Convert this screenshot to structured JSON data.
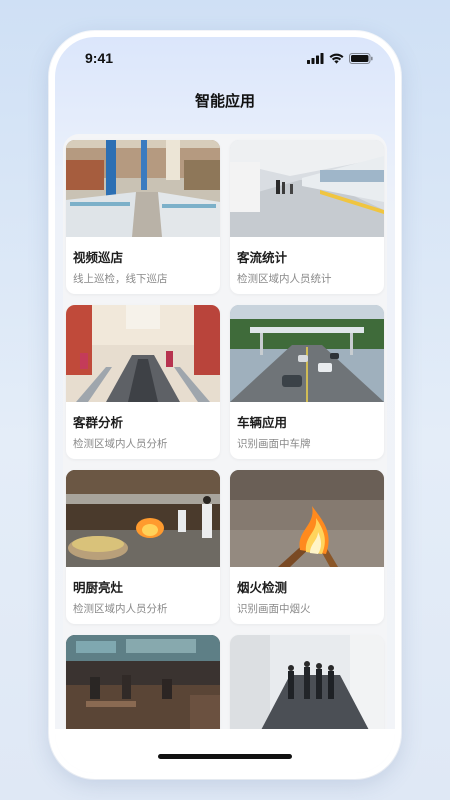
{
  "status_bar": {
    "time": "9:41",
    "icons": [
      "signal-icon",
      "wifi-icon",
      "battery-icon"
    ]
  },
  "header": {
    "title": "智能应用"
  },
  "apps": [
    {
      "id": "video-patrol",
      "title": "视频巡店",
      "desc": "线上巡检，线下巡店",
      "image": "supermarket-aisle"
    },
    {
      "id": "foot-traffic",
      "title": "客流统计",
      "desc": "检测区域内人员统计",
      "image": "metro-station-platform"
    },
    {
      "id": "customer-group",
      "title": "客群分析",
      "desc": "检测区域内人员分析",
      "image": "mall-escalator"
    },
    {
      "id": "vehicle",
      "title": "车辆应用",
      "desc": "识别画面中车牌",
      "image": "highway-toll-gate"
    },
    {
      "id": "open-kitchen",
      "title": "明厨亮灶",
      "desc": "检测区域内人员分析",
      "image": "restaurant-kitchen"
    },
    {
      "id": "fire-detection",
      "title": "烟火检测",
      "desc": "识别画面中烟火",
      "image": "bonfire-on-ground"
    },
    {
      "id": "restaurant",
      "title": "",
      "desc": "",
      "image": "restaurant-dining-hall"
    },
    {
      "id": "corridor",
      "title": "",
      "desc": "",
      "image": "office-corridor-people"
    }
  ],
  "colors": {
    "accent_bg": "#dbe6fb",
    "card_bg": "#ffffff",
    "title_text": "#1d1d1d",
    "desc_text": "#8a8a8a"
  }
}
